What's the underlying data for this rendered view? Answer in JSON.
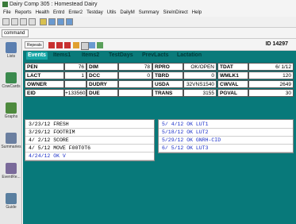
{
  "window": {
    "title": "Dairy Comp 305 : Homestead Dairy"
  },
  "menu": [
    "File",
    "Reports",
    "Health",
    "Entrd",
    "Enter2",
    "Testday",
    "Utils",
    "DailyM",
    "Summary",
    "SireInDirect",
    "Help"
  ],
  "command": {
    "value": "command"
  },
  "report": {
    "value": "Repeats"
  },
  "cow_id": "ID 14297",
  "sidebar": [
    {
      "label": "Lists",
      "icon": "lists-icon",
      "color": "#5b7fb0"
    },
    {
      "label": "CowCards",
      "icon": "cow-card-icon",
      "color": "#3b8a4e"
    },
    {
      "label": "Graphs",
      "icon": "graphs-icon",
      "color": "#4e8a3e"
    },
    {
      "label": "Summaries",
      "icon": "summaries-icon",
      "color": "#6b7fa0"
    },
    {
      "label": "EventRe...",
      "icon": "event-icon",
      "color": "#7a6a9a"
    },
    {
      "label": "Guide",
      "icon": "guide-icon",
      "color": "#5a7fa0"
    }
  ],
  "tabs": [
    "Events",
    "Items1",
    "Items2",
    "TestDays",
    "PrevLacts",
    "Lactation"
  ],
  "fields": [
    [
      {
        "label": "PEN",
        "value": "76"
      },
      {
        "label": "DIM",
        "value": "78"
      },
      {
        "label": "RPRO",
        "value": "OK/OPEN"
      },
      {
        "label": "TDAT",
        "value": "6/ 1/12"
      }
    ],
    [
      {
        "label": "LACT",
        "value": "1"
      },
      {
        "label": "DCC",
        "value": "0"
      },
      {
        "label": "TBRD",
        "value": "0"
      },
      {
        "label": "WMLK1",
        "value": "120"
      }
    ],
    [
      {
        "label": "OWNER",
        "value": ""
      },
      {
        "label": "DUDRY",
        "value": ""
      },
      {
        "label": "USDA",
        "value": "32VNS1540"
      },
      {
        "label": "CWVAL",
        "value": "2649"
      }
    ],
    [
      {
        "label": "EID",
        "value": "+133560240"
      },
      {
        "label": "DUE",
        "value": ""
      },
      {
        "label": "TRANS",
        "value": "3155"
      },
      {
        "label": "PGVAL",
        "value": "30"
      }
    ]
  ],
  "events_left": [
    {
      "text": "3/23/12 FRESH",
      "highlight": false
    },
    {
      "text": "3/29/12 FOOTRIM",
      "highlight": false
    },
    {
      "text": "4/ 2/12 SCORE",
      "highlight": false
    },
    {
      "text": "4/ 5/12 MOVE    F00T0T6",
      "highlight": false
    },
    {
      "text": "4/24/12 OK      V",
      "highlight": true
    }
  ],
  "events_right": [
    {
      "text": "5/ 4/12 OK      LUT1",
      "highlight": true
    },
    {
      "text": "5/18/12 OK      LUT2",
      "highlight": true
    },
    {
      "text": "5/29/12 OK      GNRH-CID",
      "highlight": true
    },
    {
      "text": "6/ 5/12 OK      LUT3",
      "highlight": true
    }
  ]
}
